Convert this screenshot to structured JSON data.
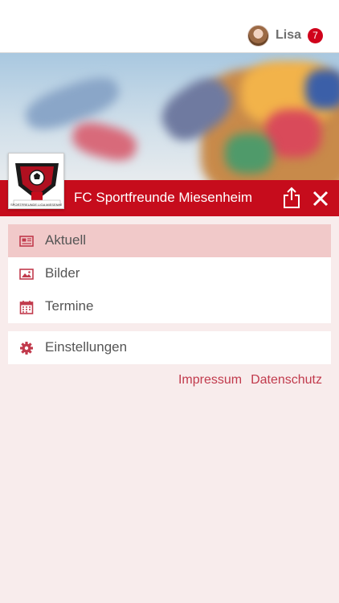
{
  "header": {
    "user_name": "Lisa",
    "notification_count": "7"
  },
  "club": {
    "name": "FC Sportfreunde Miesenheim",
    "logo_text": "SPORTFREUNDE LIGA MIESENHEIM"
  },
  "menu": {
    "items": [
      {
        "label": "Aktuell",
        "icon": "newspaper-icon",
        "active": true
      },
      {
        "label": "Bilder",
        "icon": "image-icon",
        "active": false
      },
      {
        "label": "Termine",
        "icon": "calendar-icon",
        "active": false
      }
    ],
    "settings": {
      "label": "Einstellungen",
      "icon": "gear-icon"
    }
  },
  "footer_links": {
    "impressum": "Impressum",
    "datenschutz": "Datenschutz"
  },
  "colors": {
    "brand_red": "#c60c1c",
    "active_bg": "#f1c9c9",
    "page_bg": "#f8ecec",
    "link": "#c13a4c"
  }
}
